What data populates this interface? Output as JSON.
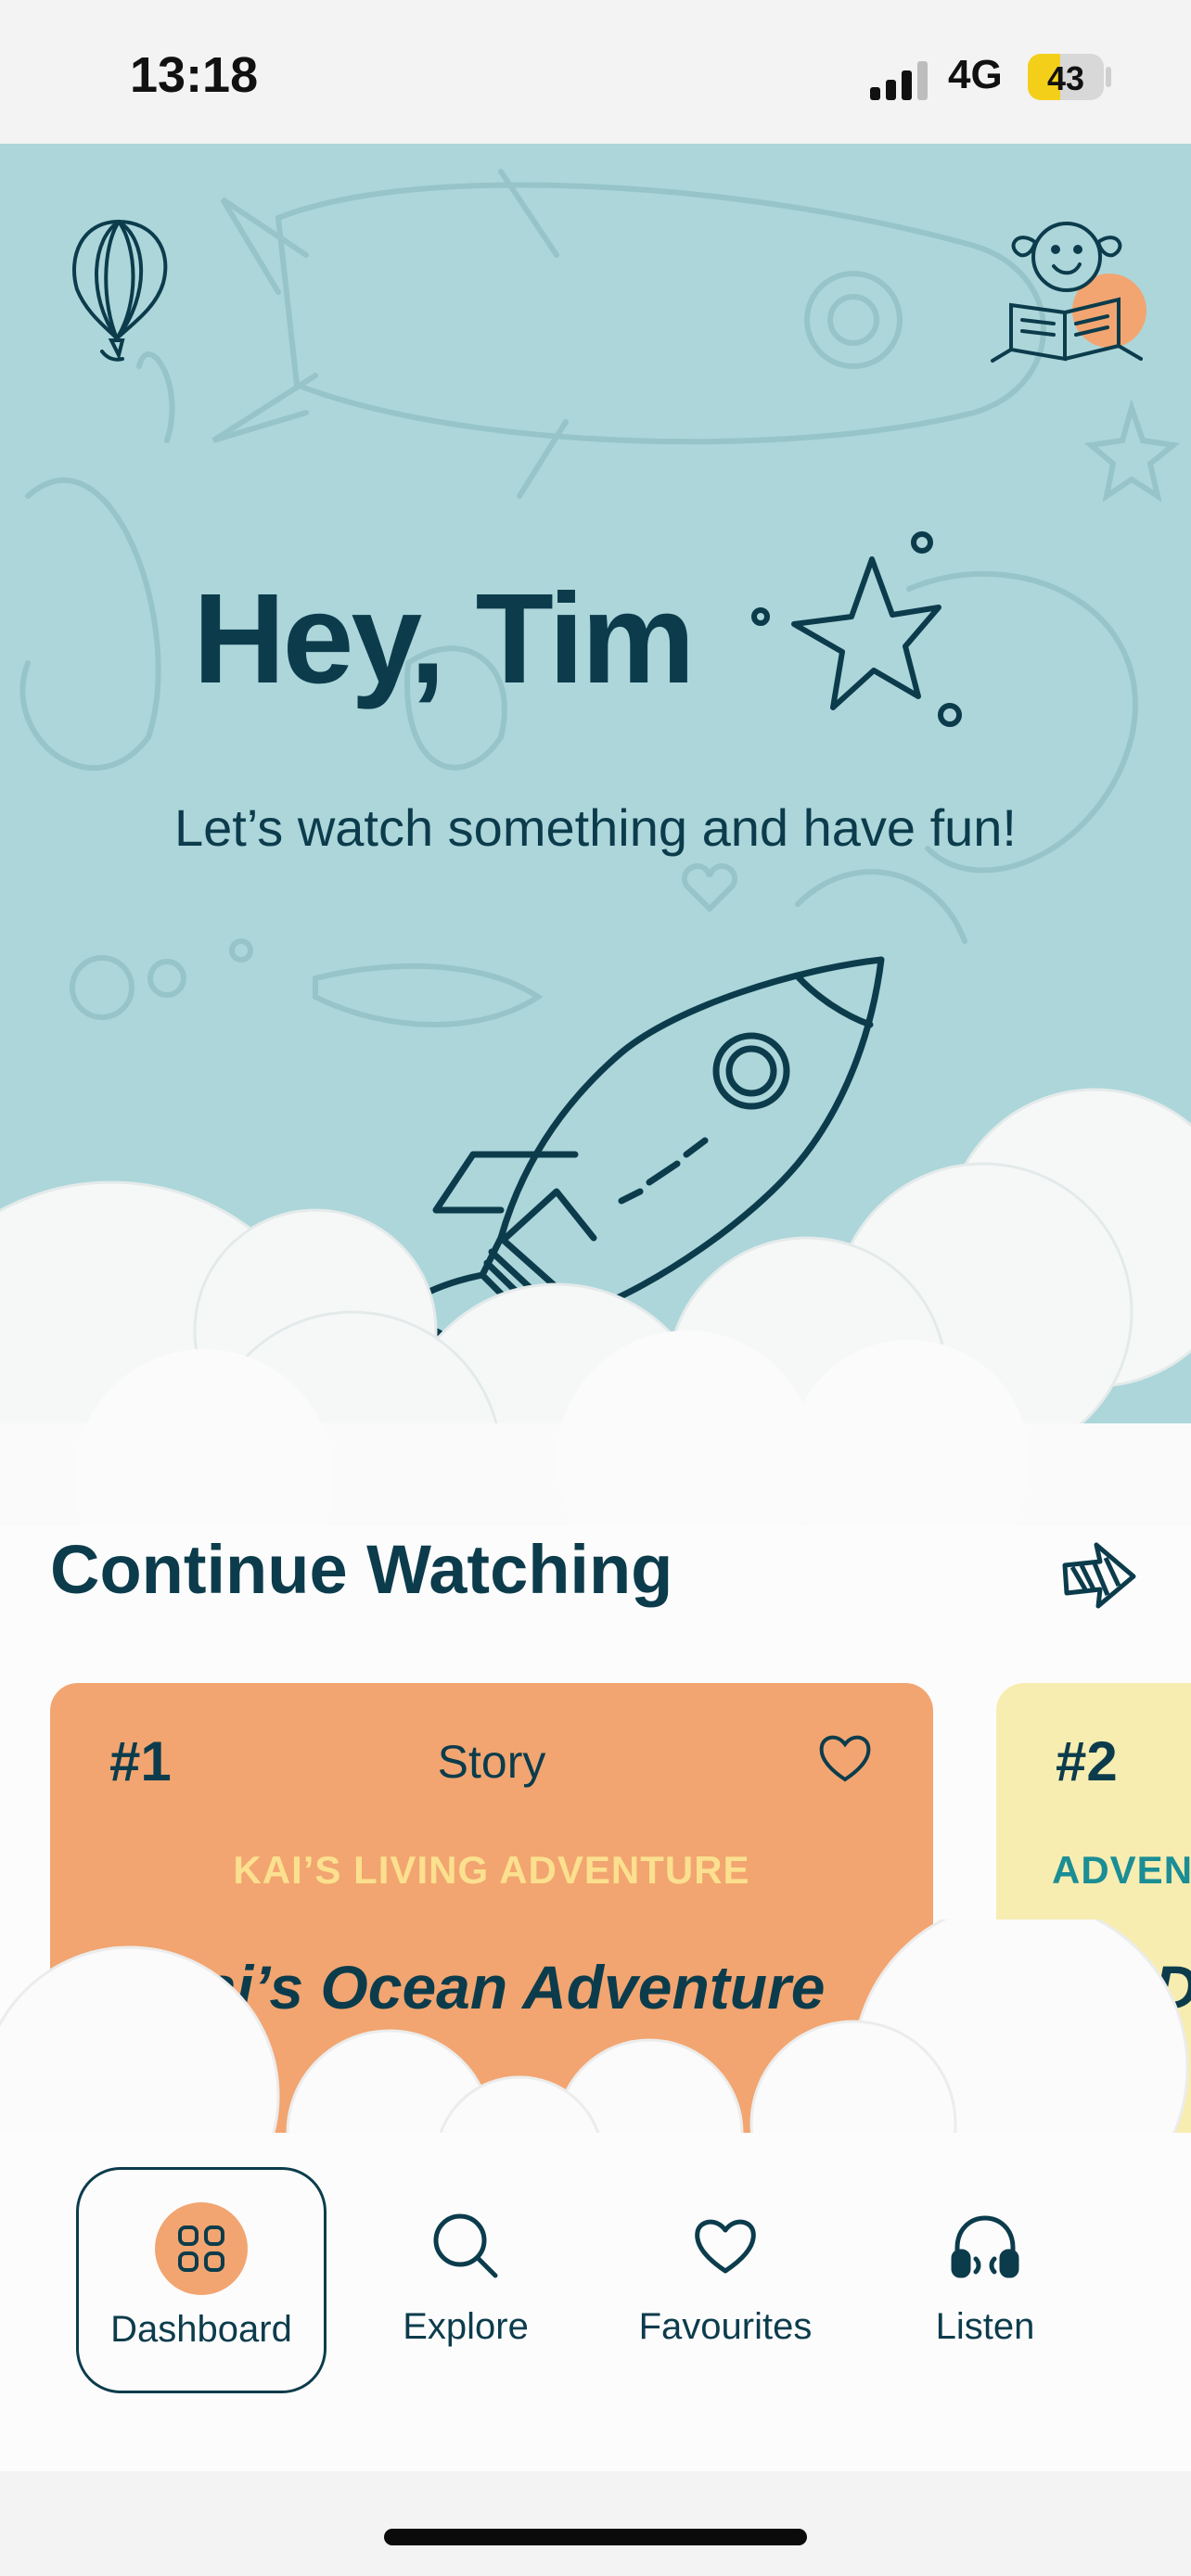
{
  "status_bar": {
    "time": "13:18",
    "network": "4G",
    "battery": "43",
    "battery_level": 0.43,
    "signal_bars": 3
  },
  "hero": {
    "greeting": "Hey, Tim",
    "subtitle": "Let’s watch something and have fun!",
    "colors": {
      "background": "#acd6da",
      "ink": "#0c3c4c",
      "accent": "#f2a570"
    }
  },
  "section": {
    "title": "Continue Watching",
    "arrow_icon": "arrow-right-icon"
  },
  "cards": [
    {
      "rank": "#1",
      "type": "Story",
      "series": "KAI’S LIVING ADVENTURE",
      "title": "Kai’s Ocean Adventure",
      "color": "#f2a570",
      "icon": "heart-icon"
    },
    {
      "rank": "#2",
      "series": "ADVENTURE",
      "title": "D",
      "color": "#f7edb0"
    }
  ],
  "nav": {
    "items": [
      {
        "label": "Dashboard",
        "icon": "grid-icon",
        "active": true
      },
      {
        "label": "Explore",
        "icon": "search-icon"
      },
      {
        "label": "Favourites",
        "icon": "heart-icon"
      },
      {
        "label": "Listen",
        "icon": "headphones-icon"
      }
    ]
  }
}
